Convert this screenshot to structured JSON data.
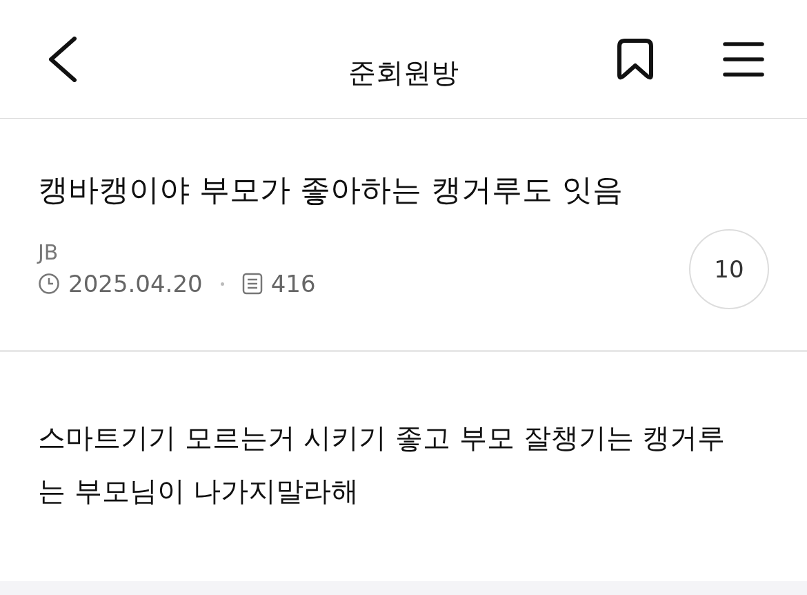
{
  "header": {
    "title": "준회원방"
  },
  "post": {
    "title": "캥바캥이야 부모가 좋아하는 캥거루도 잇음",
    "author": "JB",
    "date": "2025.04.20",
    "views": "416",
    "comment_count": "10",
    "body": "스마트기기 모르는거 시키기 좋고 부모 잘챙기는 캥거루는 부모님이 나가지말라해"
  }
}
